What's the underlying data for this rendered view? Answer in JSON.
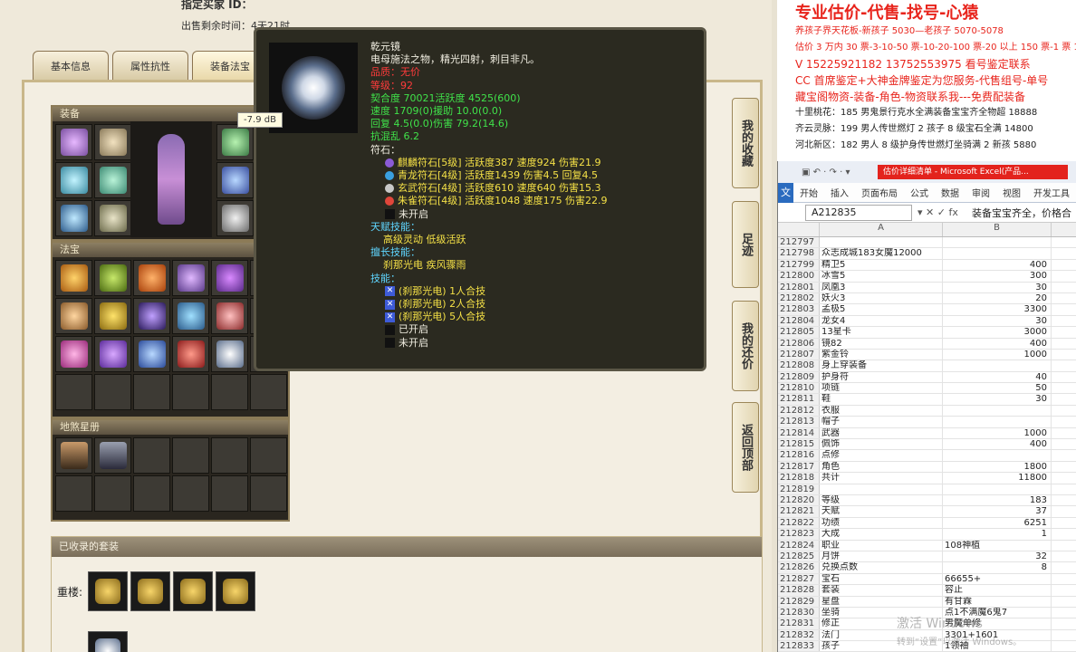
{
  "game": {
    "header": {
      "title": "指定买家 ID：",
      "time_label": "出售剩余时间：",
      "time_value": "4天21时"
    },
    "tabs": [
      {
        "label": "基本信息"
      },
      {
        "label": "属性抗性"
      },
      {
        "label": "装备法宝"
      }
    ],
    "sections": {
      "equip": "装备",
      "fabao": "法宝",
      "stars": "地煞星册",
      "suits": "已收录的套装"
    },
    "suit_label_chonglou": "重楼:",
    "side_buttons": [
      {
        "label": "我的收藏"
      },
      {
        "label": "足迹"
      },
      {
        "label": "我的还价"
      },
      {
        "label": "返回顶部"
      }
    ],
    "db_label": "-7.9 dB"
  },
  "tooltip": {
    "name": "乾元镜",
    "desc": "电母施法之物，精光四射，刺目非凡。",
    "quality": "品质：无价",
    "level": "等级：92",
    "stats": [
      "契合度   70021活跃度   4525(600)",
      "速度    1709(0)援助    10.0(0.0)",
      "回复    4.5(0.0)伤害   79.2(14.6)"
    ],
    "kanghunluan": "抗混乱 6.2",
    "fushi_title": "符石：",
    "fushi": [
      {
        "text": "麒麟符石[5级] 活跃度387 速度924 伤害21.9",
        "color": "#8b5bd6"
      },
      {
        "text": "青龙符石[4级] 活跃度1439 伤害4.5 回复4.5",
        "color": "#3aa0e0"
      },
      {
        "text": "玄武符石[4级] 活跃度610 速度640 伤害15.3",
        "color": "#c8c8c8"
      },
      {
        "text": "朱雀符石[4级] 活跃度1048 速度175 伤害22.9",
        "color": "#e0463a"
      }
    ],
    "fushi_closed": "未开启",
    "tianfu_title": "天赋技能：",
    "tianfu": "高级灵动     低级活跃",
    "shanchang_title": "擅长技能：",
    "shanchang": "刹那光电     疾风骤雨",
    "jineng_title": "技能：",
    "jineng": [
      "(刹那光电) 1人合技",
      "(刹那光电) 2人合技",
      "(刹那光电) 5人合技"
    ],
    "opened": "已开启",
    "notopened": "未开启"
  },
  "ads": {
    "title": "专业估价-代售-找号-心猿",
    "lines": [
      {
        "text": "养孩子界天花板-新孩子 5030—老孩子 5070-5078",
        "cls": ""
      },
      {
        "text": "估价 3 万内 30 票-3-10-50 票-10-20-100 票-20 以上 150 票-1 票 1",
        "cls": ""
      },
      {
        "text": "V 15225921182    13752553975  看号鉴定联系",
        "cls": "big"
      },
      {
        "text": "CC 首席鉴定+大神金牌鉴定为您服务-代售组号-单号",
        "cls": "big"
      },
      {
        "text": "藏宝阁物资-装备-角色-物资联系我---免费配装备",
        "cls": "big"
      },
      {
        "text": "十里桃花：185 男鬼景行克水全满装备宝宝齐全物超 18888",
        "cls": "blk"
      },
      {
        "text": "齐云灵脉：199 男人传世燃灯 2 孩子 8 级宝石全满 14800",
        "cls": "blk"
      },
      {
        "text": "河北新区：182 男人 8 级护身传世燃灯坐骑满 2 新孩 5880",
        "cls": "blk"
      }
    ]
  },
  "excel": {
    "qa": "▣ ↶ · ↷ · ▾",
    "title": "估价详细清单 - Microsoft Excel(产品...",
    "menu": [
      "开始",
      "插入",
      "页面布局",
      "公式",
      "数据",
      "审阅",
      "视图",
      "开发工具"
    ],
    "file": "文件",
    "namebox": "A212835",
    "fx": "▾ ✕ ✓ fx",
    "formula": "装备宝宝齐全，价格合",
    "colA": "A",
    "colB": "B",
    "rows": [
      [
        "212797",
        "",
        ""
      ],
      [
        "212798",
        "众志成城183女魔12000",
        ""
      ],
      [
        "212799",
        "精卫5",
        "400"
      ],
      [
        "212800",
        "冰雪5",
        "300"
      ],
      [
        "212801",
        "凤凰3",
        "30"
      ],
      [
        "212802",
        "妖火3",
        "20"
      ],
      [
        "212803",
        "孟极5",
        "3300"
      ],
      [
        "212804",
        "龙女4",
        "30"
      ],
      [
        "212805",
        "13星卡",
        "3000"
      ],
      [
        "212806",
        "镜82",
        "400"
      ],
      [
        "212807",
        "紫金铃",
        "1000"
      ],
      [
        "212808",
        "身上穿装备",
        ""
      ],
      [
        "212809",
        "护身符",
        "40"
      ],
      [
        "212810",
        "项链",
        "50"
      ],
      [
        "212811",
        "鞋",
        "30"
      ],
      [
        "212812",
        "衣服",
        ""
      ],
      [
        "212813",
        "帽子",
        ""
      ],
      [
        "212814",
        "武器",
        "1000"
      ],
      [
        "212815",
        "佩饰",
        "400"
      ],
      [
        "212816",
        "点修",
        ""
      ],
      [
        "212817",
        "角色",
        "1800"
      ],
      [
        "212818",
        "共计",
        "11800"
      ],
      [
        "212819",
        "",
        ""
      ],
      [
        "212820",
        "等级",
        "183"
      ],
      [
        "212821",
        "天赋",
        "37"
      ],
      [
        "212822",
        "功绩",
        "6251"
      ],
      [
        "212823",
        "大成",
        "1"
      ],
      [
        "212824",
        "职业",
        "108神植"
      ],
      [
        "212825",
        "月饼",
        "32"
      ],
      [
        "212826",
        "兑换点数",
        "8"
      ],
      [
        "212827",
        "宝石",
        "66655+"
      ],
      [
        "212828",
        "套装",
        "容止"
      ],
      [
        "212829",
        "星盘",
        "有甘霖"
      ],
      [
        "212830",
        "坐骑",
        "点1不满魔6鬼7"
      ],
      [
        "212831",
        "修正",
        "男魔单修"
      ],
      [
        "212832",
        "法门",
        "3301+1601"
      ],
      [
        "212833",
        "孩子",
        "1领袖"
      ]
    ]
  },
  "watermark": {
    "line1": "激活 Windows",
    "line2": "转到“设置”以激活 Windows。"
  }
}
